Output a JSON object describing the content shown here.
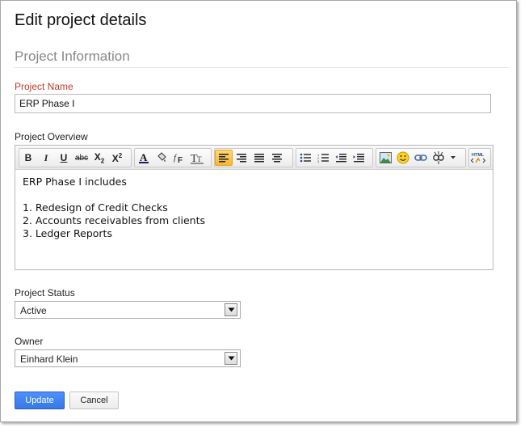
{
  "dialog": {
    "title": "Edit project details",
    "section_header": "Project Information"
  },
  "project_name": {
    "label": "Project Name",
    "value": "ERP Phase I"
  },
  "project_overview": {
    "label": "Project Overview",
    "toolbar": {
      "bold": "B",
      "italic": "I",
      "underline": "U",
      "strikethrough": "abc",
      "subscript": "X2",
      "superscript": "X2",
      "align_left_active": true
    },
    "content": {
      "intro": "ERP Phase I includes",
      "items": [
        "1. Redesign of Credit Checks",
        "2. Accounts receivables from clients",
        "3. Ledger Reports"
      ]
    }
  },
  "project_status": {
    "label": "Project Status",
    "selected": "Active"
  },
  "owner": {
    "label": "Owner",
    "selected": "Einhard Klein"
  },
  "actions": {
    "update_label": "Update",
    "cancel_label": "Cancel"
  },
  "colors": {
    "required_label": "#c0392b",
    "primary_button": "#4d90fe",
    "active_tool": "#f7b733"
  }
}
